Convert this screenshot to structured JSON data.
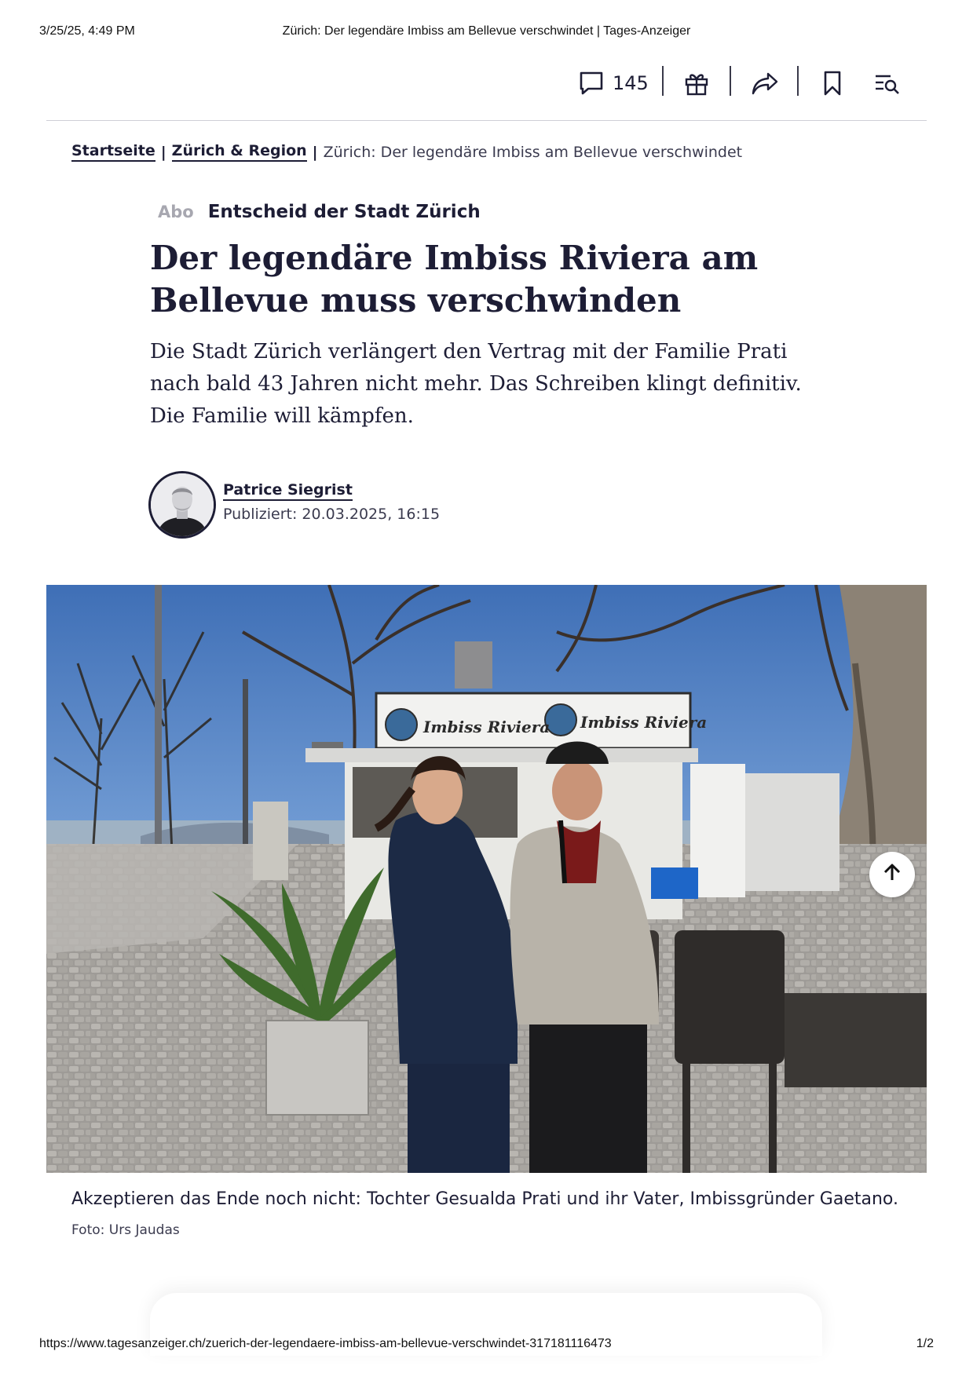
{
  "print_header": {
    "datetime": "3/25/25, 4:49 PM",
    "title": "Zürich: Der legendäre Imbiss am Bellevue verschwindet | Tages-Anzeiger"
  },
  "toolbar": {
    "comment_count": "145",
    "icons": [
      "comment-icon",
      "gift-icon",
      "share-icon",
      "bookmark-icon",
      "toc-search-icon"
    ]
  },
  "breadcrumb": {
    "home": "Startseite",
    "section": "Zürich & Region",
    "current": "Zürich: Der legendäre Imbiss am Bellevue verschwindet",
    "separator": "|"
  },
  "article": {
    "badge": "Abo",
    "kicker": "Entscheid der Stadt Zürich",
    "headline": "Der legendäre Imbiss Riviera am Bellevue muss verschwinden",
    "lead": "Die Stadt Zürich verlängert den Vertrag mit der Familie Prati nach bald 43 Jahren nicht mehr. Das Schreiben klingt definitiv. Die Familie will kämpfen.",
    "author": "Patrice Siegrist",
    "published": "Publiziert: 20.03.2025, 16:15"
  },
  "hero": {
    "sign_text": "Imbiss Riviera",
    "caption": "Akzeptieren das Ende noch nicht: Tochter Gesualda Prati und ihr Vater, Imbissgründer Gaetano.",
    "credit": "Foto: Urs Jaudas"
  },
  "print_footer": {
    "url": "https://www.tagesanzeiger.ch/zuerich-der-legendaere-imbiss-am-bellevue-verschwindet-317181116473",
    "page": "1/2"
  },
  "colors": {
    "ink": "#1d1d35",
    "muted": "#a7a7b0",
    "sky": "#5b86c6"
  }
}
